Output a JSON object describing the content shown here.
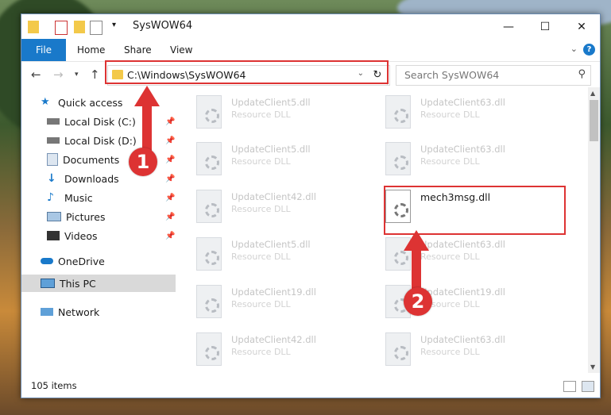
{
  "window": {
    "title": "SysWOW64"
  },
  "ribbon": {
    "tabs": [
      "File",
      "Home",
      "Share",
      "View"
    ]
  },
  "address": {
    "path": "C:\\Windows\\SysWOW64"
  },
  "search": {
    "placeholder": "Search SysWOW64"
  },
  "sidebar": {
    "items": [
      {
        "label": "Quick access"
      },
      {
        "label": "Local Disk (C:)"
      },
      {
        "label": "Local Disk (D:)"
      },
      {
        "label": "Documents"
      },
      {
        "label": "Downloads"
      },
      {
        "label": "Music"
      },
      {
        "label": "Pictures"
      },
      {
        "label": "Videos"
      },
      {
        "label": "OneDrive"
      },
      {
        "label": "This PC"
      },
      {
        "label": "Network"
      }
    ]
  },
  "files": {
    "left": [
      {
        "name": "UpdateClient5.dll",
        "type": "Resource DLL"
      },
      {
        "name": "UpdateClient5.dll",
        "type": "Resource DLL"
      },
      {
        "name": "UpdateClient42.dll",
        "type": "Resource DLL"
      },
      {
        "name": "UpdateClient5.dll",
        "type": "Resource DLL"
      },
      {
        "name": "UpdateClient19.dll",
        "type": "Resource DLL"
      },
      {
        "name": "UpdateClient42.dll",
        "type": "Resource DLL"
      }
    ],
    "right": [
      {
        "name": "UpdateClient63.dll",
        "type": "Resource DLL"
      },
      {
        "name": "UpdateClient63.dll",
        "type": "Resource DLL"
      },
      {
        "name": "mech3msg.dll",
        "type": ""
      },
      {
        "name": "UpdateClient63.dll",
        "type": "Resource DLL"
      },
      {
        "name": "UpdateClient19.dll",
        "type": "Resource DLL"
      },
      {
        "name": "UpdateClient63.dll",
        "type": "Resource DLL"
      }
    ]
  },
  "status": {
    "item_count": "105 items"
  },
  "callouts": {
    "one": "1",
    "two": "2"
  },
  "colors": {
    "accent": "#1979ca",
    "highlight": "#dd3333"
  }
}
